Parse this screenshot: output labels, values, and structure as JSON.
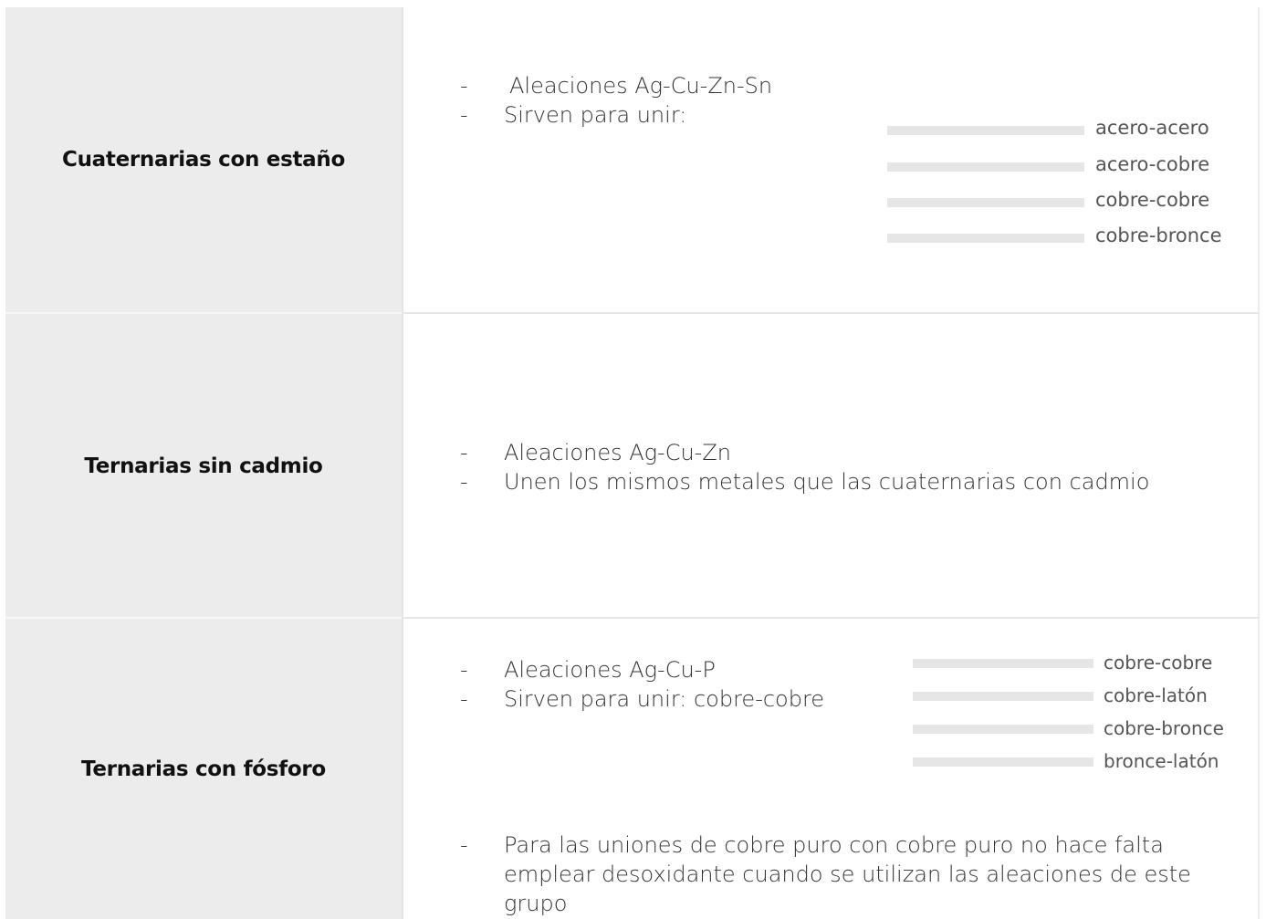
{
  "rows": [
    {
      "label": "Cuaternarias con estaño",
      "bullets": [
        "Aleaciones Ag-Cu-Zn-Sn",
        "Sirven para unir:"
      ],
      "pairs": [
        "acero-acero",
        "acero-cobre",
        "cobre-cobre",
        "cobre-bronce"
      ]
    },
    {
      "label": "Ternarias sin cadmio",
      "bullets": [
        "Aleaciones Ag-Cu-Zn",
        "Unen los mismos metales que las cuaternarias con cadmio"
      ]
    },
    {
      "label": "Ternarias con fósforo",
      "bullets": [
        "Aleaciones Ag-Cu-P",
        "Sirven para unir: cobre-cobre"
      ],
      "pairs": [
        "cobre-cobre",
        "cobre-latón",
        "cobre-bronce",
        "bronce-latón"
      ],
      "note": "Para las uniones de cobre puro con cobre puro no hace falta emplear desoxidante cuando se utilizan las aleaciones de este grupo"
    }
  ],
  "dash": "-"
}
